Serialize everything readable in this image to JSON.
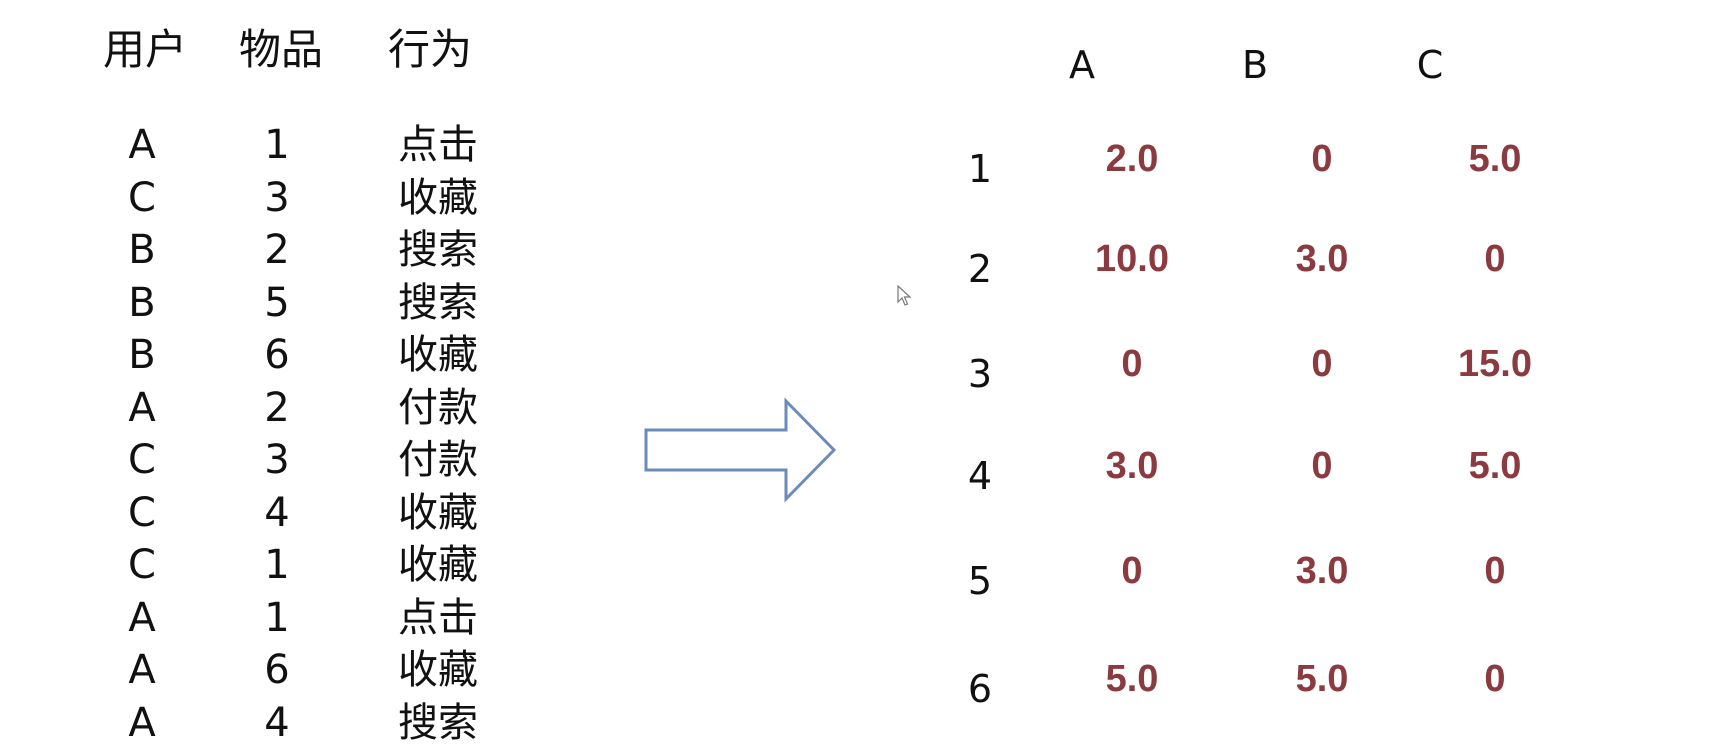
{
  "log_table": {
    "headers": [
      "用户",
      "物品",
      "行为"
    ],
    "rows": [
      [
        "A",
        "1",
        "点击"
      ],
      [
        "C",
        "3",
        "收藏"
      ],
      [
        "B",
        "2",
        "搜索"
      ],
      [
        "B",
        "5",
        "搜索"
      ],
      [
        "B",
        "6",
        "收藏"
      ],
      [
        "A",
        "2",
        "付款"
      ],
      [
        "C",
        "3",
        "付款"
      ],
      [
        "C",
        "4",
        "收藏"
      ],
      [
        "C",
        "1",
        "收藏"
      ],
      [
        "A",
        "1",
        "点击"
      ],
      [
        "A",
        "6",
        "收藏"
      ],
      [
        "A",
        "4",
        "搜索"
      ]
    ]
  },
  "matrix": {
    "columns": [
      "A",
      "B",
      "C"
    ],
    "rows": [
      {
        "label": "1",
        "values": [
          "2.0",
          "0",
          "5.0"
        ]
      },
      {
        "label": "2",
        "values": [
          "10.0",
          "3.0",
          "0"
        ]
      },
      {
        "label": "3",
        "values": [
          "0",
          "0",
          "15.0"
        ]
      },
      {
        "label": "4",
        "values": [
          "3.0",
          "0",
          "5.0"
        ]
      },
      {
        "label": "5",
        "values": [
          "0",
          "3.0",
          "0"
        ]
      },
      {
        "label": "6",
        "values": [
          "5.0",
          "5.0",
          "0"
        ]
      }
    ],
    "value_color": "#8b3a3f"
  },
  "arrow": {
    "icon": "right-arrow-icon",
    "stroke": "#6b8cba"
  }
}
